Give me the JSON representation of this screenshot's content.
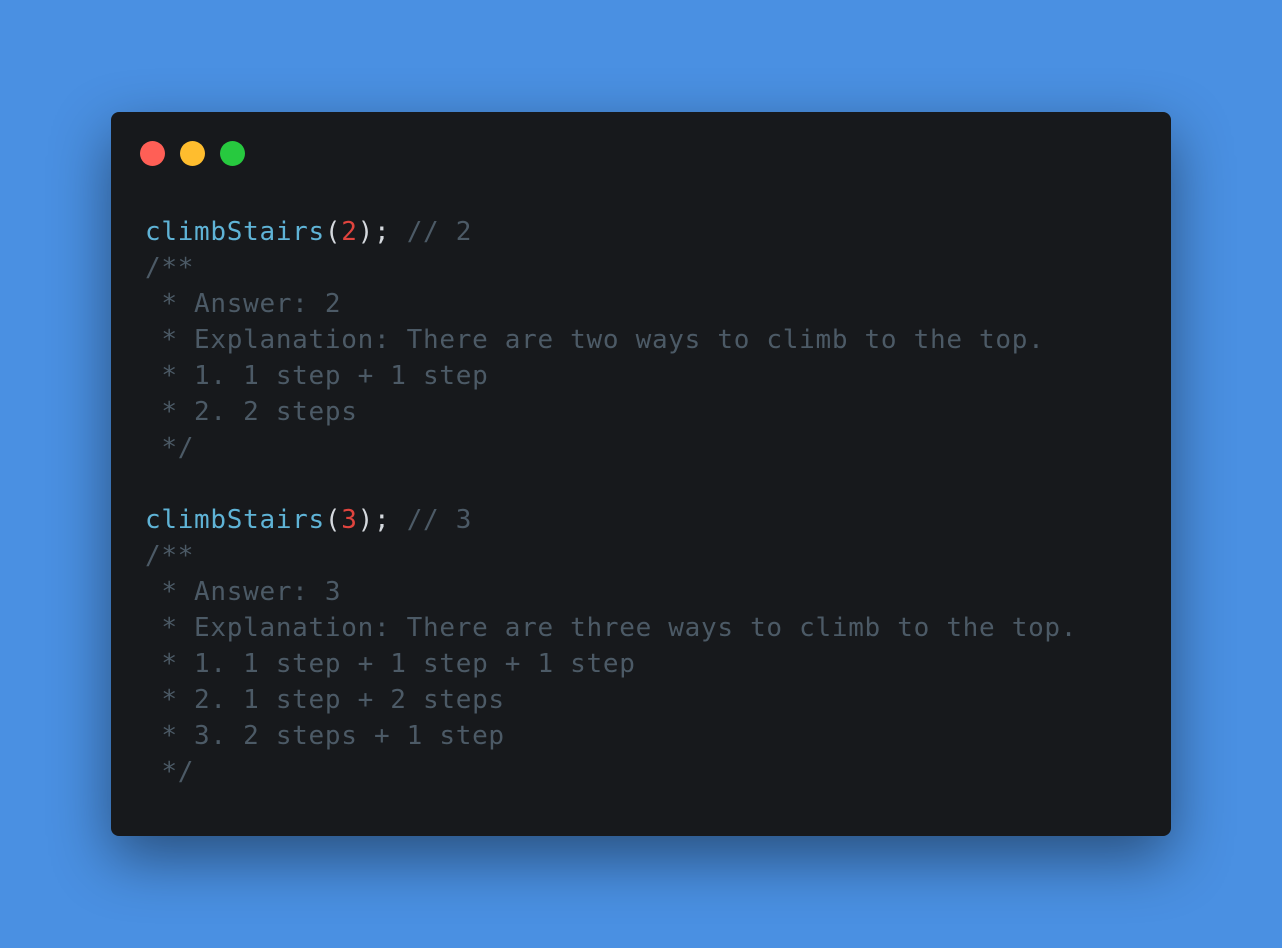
{
  "colors": {
    "background": "#4a90e2",
    "window": "#17191c",
    "close": "#ff5f56",
    "minimize": "#ffbd2e",
    "zoom": "#27c93f",
    "function": "#5fb3d6",
    "number": "#e0443e",
    "punctuation": "#d5d9de",
    "comment": "#4c5a66"
  },
  "window_controls": {
    "close": "close-dot",
    "minimize": "minimize-dot",
    "zoom": "zoom-dot"
  },
  "code": {
    "blocks": [
      {
        "call": {
          "fn": "climbStairs",
          "open": "(",
          "arg": "2",
          "close": ");",
          "comment": "// 2"
        },
        "doc": [
          "/**",
          " * Answer: 2",
          " * Explanation: There are two ways to climb to the top.",
          " * 1. 1 step + 1 step",
          " * 2. 2 steps",
          " */"
        ]
      },
      {
        "call": {
          "fn": "climbStairs",
          "open": "(",
          "arg": "3",
          "close": ");",
          "comment": "// 3"
        },
        "doc": [
          "/**",
          " * Answer: 3",
          " * Explanation: There are three ways to climb to the top.",
          " * 1. 1 step + 1 step + 1 step",
          " * 2. 1 step + 2 steps",
          " * 3. 2 steps + 1 step",
          " */"
        ]
      }
    ]
  }
}
